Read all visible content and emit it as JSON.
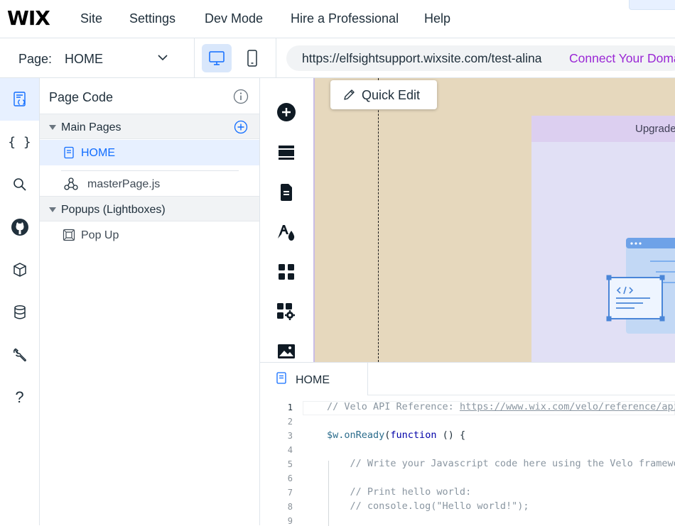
{
  "brand": {
    "logo": "WIX"
  },
  "top_menu": [
    "Site",
    "Settings",
    "Dev Mode",
    "Hire a Professional",
    "Help"
  ],
  "page_selector": {
    "label": "Page:",
    "value": "HOME"
  },
  "devices": {
    "desktop": "desktop-icon",
    "mobile": "mobile-icon",
    "active": "desktop"
  },
  "url_bar": {
    "url": "https://elfsightsupport.wixsite.com/test-alina",
    "connect": "Connect Your Domain"
  },
  "rail": [
    "page-code-icon",
    "code-braces-icon",
    "search-icon",
    "github-icon",
    "package-icon",
    "database-icon",
    "wrench-icon",
    "help-icon"
  ],
  "page_code": {
    "title": "Page Code",
    "main_pages": {
      "label": "Main Pages",
      "items": [
        "HOME"
      ]
    },
    "master_page": "masterPage.js",
    "popups": {
      "label": "Popups (Lightboxes)",
      "items": [
        "Pop Up"
      ]
    }
  },
  "canvas": {
    "quick_edit": "Quick Edit",
    "upgrade": "Upgrade"
  },
  "editor": {
    "tab": "HOME",
    "lines": [
      {
        "n": "1",
        "parts": [
          [
            "c-comment",
            "// Velo API Reference: "
          ],
          [
            "c-link",
            "https://www.wix.com/velo/reference/api-overview"
          ]
        ]
      },
      {
        "n": "2",
        "parts": []
      },
      {
        "n": "3",
        "parts": [
          [
            "c-fn",
            "$w.onReady"
          ],
          [
            "c-plain",
            "("
          ],
          [
            "c-kw",
            "function"
          ],
          [
            "c-plain",
            " () {"
          ]
        ]
      },
      {
        "n": "4",
        "parts": []
      },
      {
        "n": "5",
        "parts": [
          [
            "c-comment",
            "    // Write your Javascript code here using the Velo framework API"
          ]
        ]
      },
      {
        "n": "6",
        "parts": []
      },
      {
        "n": "7",
        "parts": [
          [
            "c-comment",
            "    // Print hello world:"
          ]
        ]
      },
      {
        "n": "8",
        "parts": [
          [
            "c-comment",
            "    // console.log(\"Hello world!\");"
          ]
        ]
      },
      {
        "n": "9",
        "parts": []
      }
    ]
  },
  "colors": {
    "accent": "#116dff",
    "connect": "#9a27d5",
    "selected_bg": "#e7f0ff",
    "canvas_bg": "#e6d8bd"
  }
}
